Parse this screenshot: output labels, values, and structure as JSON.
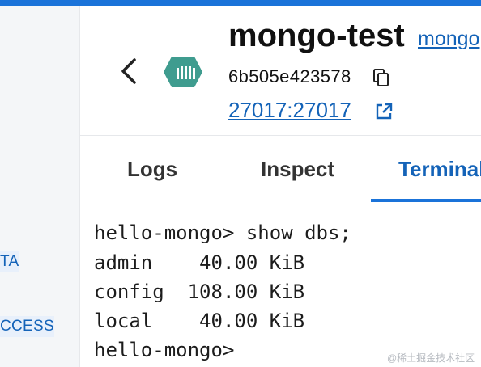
{
  "sidebar": {
    "items": [
      {
        "label": "TA"
      },
      {
        "label": "CCESS"
      }
    ]
  },
  "header": {
    "title": "mongo-test",
    "image_link": "mongo",
    "container_id": "6b505e423578",
    "port_link": "27017:27017"
  },
  "tabs": [
    {
      "label": "Logs",
      "active": false
    },
    {
      "label": "Inspect",
      "active": false
    },
    {
      "label": "Terminal",
      "active": true
    }
  ],
  "terminal": {
    "lines": [
      "hello-mongo> show dbs;",
      "admin    40.00 KiB",
      "config  108.00 KiB",
      "local    40.00 KiB",
      "hello-mongo>"
    ]
  },
  "watermark": "@稀土掘金技术社区",
  "colors": {
    "accent": "#1a73d9",
    "link": "#1463b8",
    "container_icon": "#3f9c8f"
  },
  "icons": [
    "chevron-left-icon",
    "container-icon",
    "copy-icon",
    "external-link-icon"
  ]
}
